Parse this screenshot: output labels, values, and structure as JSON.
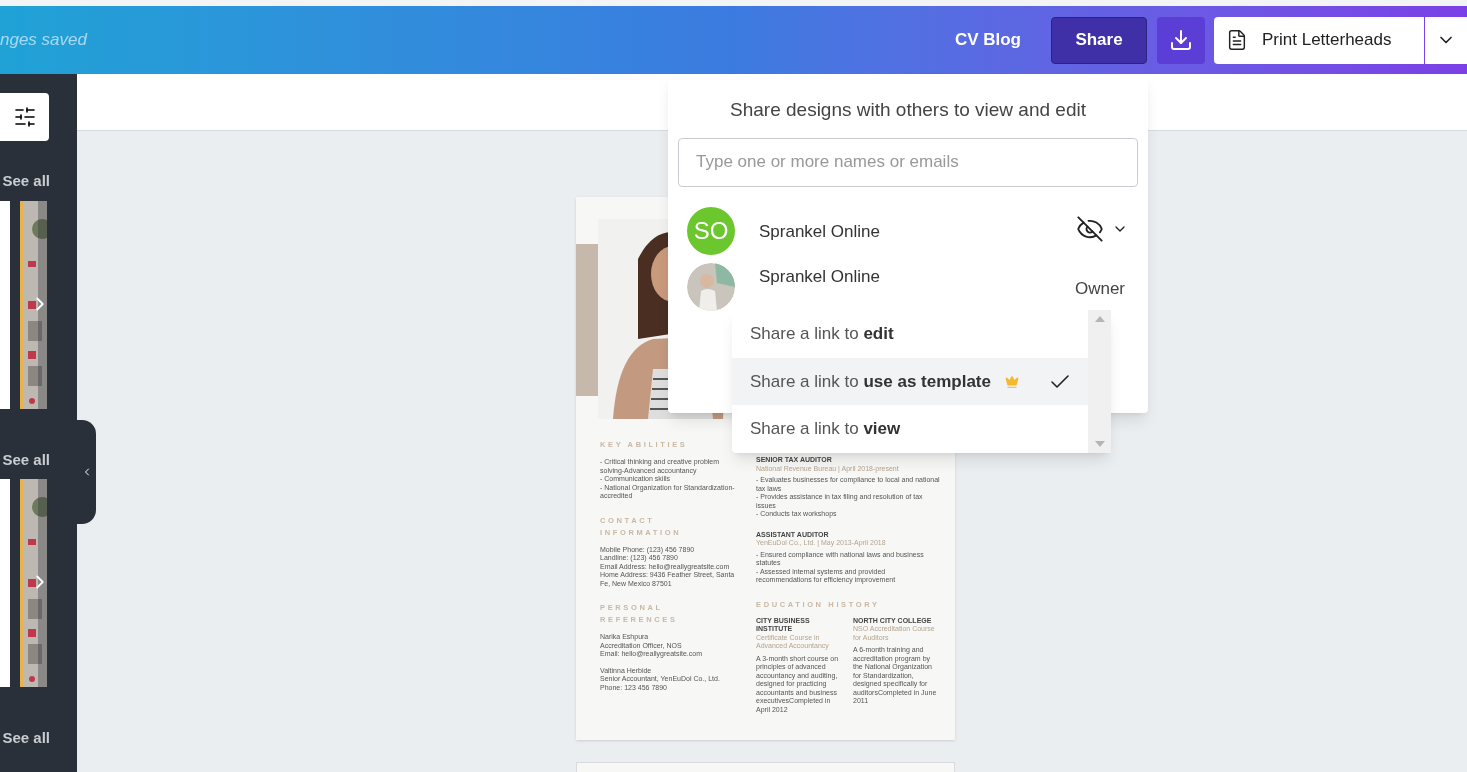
{
  "topbar": {
    "save_status": "nges saved",
    "title": "CV Blog",
    "share_button": "Share",
    "print_button": "Print Letterheads"
  },
  "sidebar": {
    "see_all": [
      "See all",
      "See all",
      "See all"
    ]
  },
  "share_panel": {
    "heading": "Share designs with others to view and edit",
    "input": {
      "placeholder": "Type one or more names or emails"
    },
    "people": [
      {
        "kind": "initials",
        "initials": "SO",
        "name": "Sprankel Online",
        "hidden": true
      },
      {
        "name": "Sprankel Online",
        "role": "Owner"
      }
    ]
  },
  "link_menu": {
    "options": [
      {
        "label": "Share a link to **edit**",
        "selected": false,
        "premium": false
      },
      {
        "label": "Share a link to **use as template**",
        "selected": true,
        "premium": true
      },
      {
        "label": "Share a link to **view**",
        "selected": false,
        "premium": false
      }
    ]
  },
  "resume": {
    "left": [
      {
        "heading": "KEY ABILITIES",
        "groups": [
          [
            "- Critical thinking and creative problem solving-Advanced accountancy",
            "- Communication skills",
            "- National Organization for Standardization-accredited"
          ]
        ]
      },
      {
        "heading": "CONTACT INFORMATION",
        "groups": [
          [
            "Mobile Phone: (123) 456 7890",
            "Landline: (123) 456 7890",
            "Email Address: hello@reallygreatsite.com",
            "Home Address: 9436 Feather Street, Santa Fe, New Mexico 87501"
          ]
        ]
      },
      {
        "heading": "PERSONAL REFERENCES",
        "groups": [
          [
            "Narika Eshpura",
            "Accreditation Officer, NOS",
            "Email: hello@reallygreatsite.com"
          ],
          [
            "Valtinna Herbide",
            "Senior Accountant, YenEuDol Co., Ltd.",
            "Phone: 123 456 7890"
          ]
        ]
      }
    ],
    "jobs": [
      {
        "title": "SENIOR TAX AUDITOR",
        "subtitle": "National Revenue Bureau | April 2018-present",
        "bullets": [
          "- Evaluates businesses for compliance to local and national tax laws",
          "- Provides assistance in tax filing and resolution of tax issues",
          "- Conducts tax workshops"
        ]
      },
      {
        "title": "ASSISTANT AUDITOR",
        "subtitle": "YenEuDol Co., Ltd. | May 2013-April 2018",
        "bullets": [
          "- Ensured compliance with national laws and business statutes",
          "- Assessed internal systems and provided recommendations for efficiency improvement"
        ]
      }
    ],
    "education_heading": "EDUCATION HISTORY",
    "schools": [
      {
        "name": "CITY BUSINESS INSTITUTE",
        "course": "Certificate Course in Advanced Accountancy",
        "description": "A 3-month short course on principles of advanced accountancy and auditing, designed for practicing accountants and business executivesCompleted in April 2012"
      },
      {
        "name": "NORTH CITY COLLEGE",
        "course": "NSO Accreditation Course for Auditors",
        "description": "A 6-month training and accreditation program by the National Organization for Standardization, designed specifically for auditorsCompleted in June 2011"
      }
    ]
  }
}
